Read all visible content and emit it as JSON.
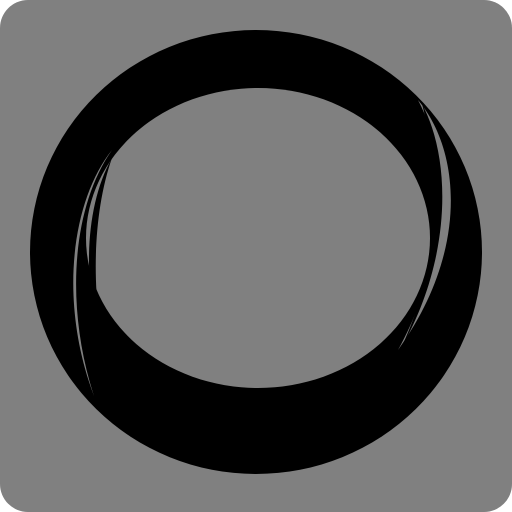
{
  "app_icon": {
    "name": "ring-logo-icon",
    "colors": {
      "background": "#808080",
      "ring": "#000000"
    }
  }
}
